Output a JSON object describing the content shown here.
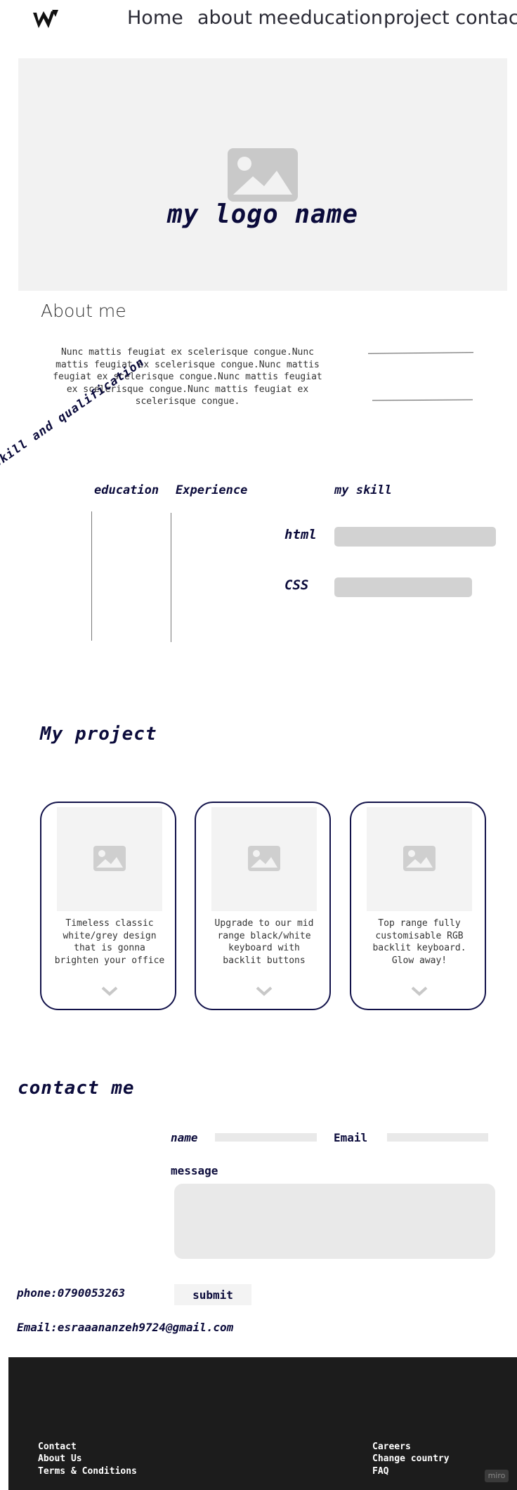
{
  "nav": {
    "logo_icon": "w-logo-icon",
    "items": [
      "Home",
      "about me",
      "education",
      "project contact"
    ]
  },
  "hero": {
    "image_icon": "image-placeholder-icon",
    "title": "my logo name"
  },
  "about": {
    "heading": "About me",
    "text": "Nunc mattis feugiat ex scelerisque congue.Nunc mattis feugiat ex scelerisque congue.Nunc mattis feugiat ex scelerisque congue.Nunc mattis feugiat ex scelerisque congue.Nunc mattis feugiat ex scelerisque congue."
  },
  "skills": {
    "rotated_title": "skill and qualification",
    "col_education": "education",
    "col_experience": "Experience",
    "col_my_skill": "my skill",
    "items": [
      {
        "name": "html",
        "level": 1.0
      },
      {
        "name": "CSS",
        "level": 0.85
      }
    ]
  },
  "projects": {
    "heading": "My project",
    "cards": [
      {
        "text": "Timeless classic white/grey design that is gonna brighten your office"
      },
      {
        "text": "Upgrade to our mid range black/white keyboard with backlit buttons"
      },
      {
        "text": "Top range fully customisable RGB backlit keyboard. Glow away!"
      }
    ]
  },
  "contact": {
    "heading": "contact me",
    "name_label": "name",
    "email_label": "Email",
    "message_label": "message",
    "submit_label": "submit",
    "phone": "phone:0790053263",
    "email_line": "Email:esraaananzeh9724@gmail.com"
  },
  "footer": {
    "left_links": [
      "Contact",
      "About Us",
      "Terms & Conditions"
    ],
    "right_links": [
      "Careers",
      "Change country",
      "FAQ"
    ],
    "badge": "miro"
  }
}
